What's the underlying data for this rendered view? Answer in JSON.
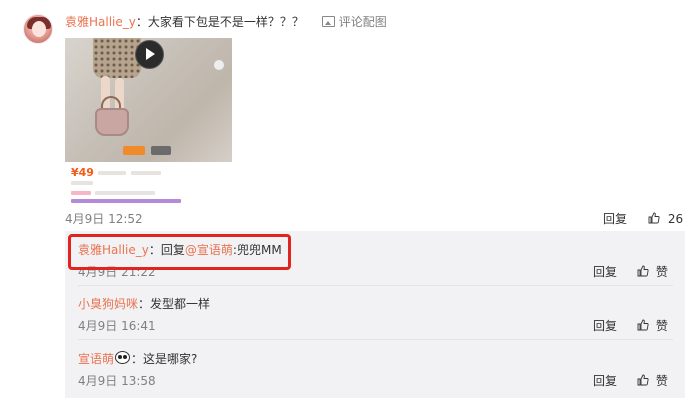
{
  "post": {
    "username": "袁雅Hallie_y",
    "separator": "：",
    "text": "大家看下包是不是一样？？？",
    "pic_link_label": "评论配图",
    "thumbnail": {
      "price": "¥49"
    },
    "date": "4月9日 12:52",
    "reply_label": "回复",
    "like_count": "26"
  },
  "replies": [
    {
      "username": "袁雅Hallie_y",
      "separator": "：",
      "reply_prefix": "回复",
      "mention": "@宣语萌",
      "text": ":兜兜MM",
      "date": "4月9日 21:22",
      "reply_label": "回复",
      "like_label": "赞",
      "highlighted": true
    },
    {
      "username": "小臭狗妈咪",
      "separator": "：",
      "text": "发型都一样",
      "date": "4月9日 16:41",
      "reply_label": "回复",
      "like_label": "赞"
    },
    {
      "username": "宣语萌",
      "separator": "：",
      "emoji": "panda-emoji",
      "text": "这是哪家?",
      "date": "4月9日 13:58",
      "reply_label": "回复",
      "like_label": "赞"
    }
  ],
  "colors": {
    "username": "#eb7350",
    "highlight": "#e0241f",
    "reply_bg": "#f2f2f5"
  }
}
